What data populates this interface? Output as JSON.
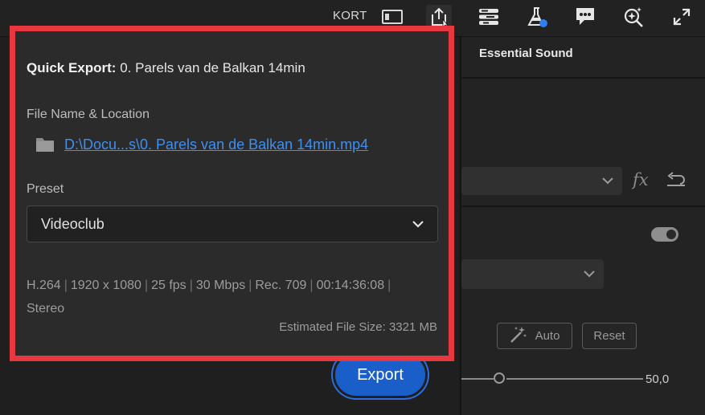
{
  "topbar": {
    "kort_label": "KORT",
    "icons": [
      "panel-icon",
      "export-icon",
      "lines-icon",
      "flask-icon",
      "comment-icon",
      "search-sparkle-icon",
      "expand-icon"
    ]
  },
  "right_panel": {
    "title": "Essential Sound",
    "fx_label": "fx",
    "auto_label": "Auto",
    "reset_label": "Reset",
    "slider_value": "50,0"
  },
  "quick_export": {
    "title_prefix": "Quick Export:",
    "title_name": "0. Parels van de Balkan 14min",
    "file_label": "File Name & Location",
    "file_path": "D:\\Docu...s\\0. Parels van de Balkan 14min.mp4",
    "preset_label": "Preset",
    "preset_value": "Videoclub",
    "specs": [
      "H.264",
      "1920 x 1080",
      "25 fps",
      "30 Mbps",
      "Rec. 709",
      "00:14:36:08"
    ],
    "audio": "Stereo",
    "estimated_size": "Estimated File Size: 3321 MB"
  },
  "export_button": {
    "label": "Export"
  },
  "colors": {
    "highlight_border": "#e8383f",
    "link": "#3f8ff0",
    "export_button": "#1a5fc9"
  }
}
